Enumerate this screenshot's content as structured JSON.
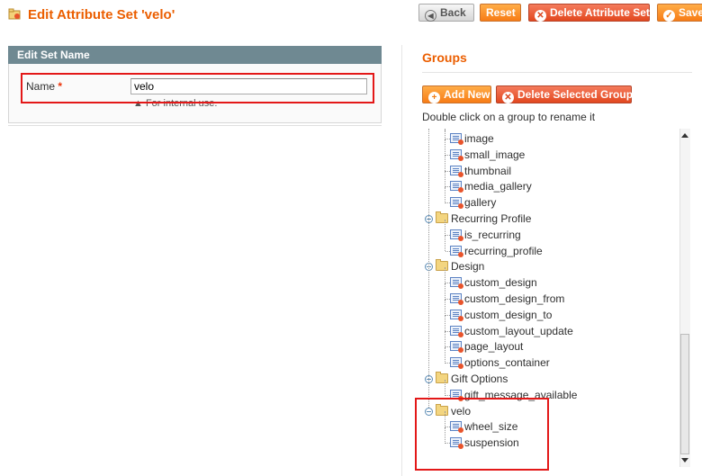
{
  "header": {
    "title": "Edit Attribute Set 'velo'",
    "buttons": {
      "back": "Back",
      "reset": "Reset",
      "delete": "Delete Attribute Set",
      "save": "Save"
    }
  },
  "edit_set": {
    "section_title": "Edit Set Name",
    "name_label": "Name",
    "required_mark": "*",
    "name_value": "velo",
    "note": "For internal use."
  },
  "groups": {
    "title": "Groups",
    "add_new_label": "Add New",
    "delete_group_label": "Delete Selected Group",
    "hint": "Double click on a group to rename it",
    "tree": [
      {
        "type": "attribute",
        "label": "image"
      },
      {
        "type": "attribute",
        "label": "small_image"
      },
      {
        "type": "attribute",
        "label": "thumbnail"
      },
      {
        "type": "attribute",
        "label": "media_gallery"
      },
      {
        "type": "attribute",
        "label": "gallery"
      },
      {
        "type": "group",
        "label": "Recurring Profile"
      },
      {
        "type": "attribute",
        "label": "is_recurring"
      },
      {
        "type": "attribute",
        "label": "recurring_profile"
      },
      {
        "type": "group",
        "label": "Design"
      },
      {
        "type": "attribute",
        "label": "custom_design"
      },
      {
        "type": "attribute",
        "label": "custom_design_from"
      },
      {
        "type": "attribute",
        "label": "custom_design_to"
      },
      {
        "type": "attribute",
        "label": "custom_layout_update"
      },
      {
        "type": "attribute",
        "label": "page_layout"
      },
      {
        "type": "attribute",
        "label": "options_container"
      },
      {
        "type": "group",
        "label": "Gift Options"
      },
      {
        "type": "attribute",
        "label": "gift_message_available"
      },
      {
        "type": "group",
        "label": "velo"
      },
      {
        "type": "attribute",
        "label": "wheel_size"
      },
      {
        "type": "attribute",
        "label": "suspension"
      }
    ]
  },
  "colors": {
    "accent_orange": "#eb5e00",
    "header_bar": "#6f8992",
    "highlight_red": "#e31818"
  }
}
